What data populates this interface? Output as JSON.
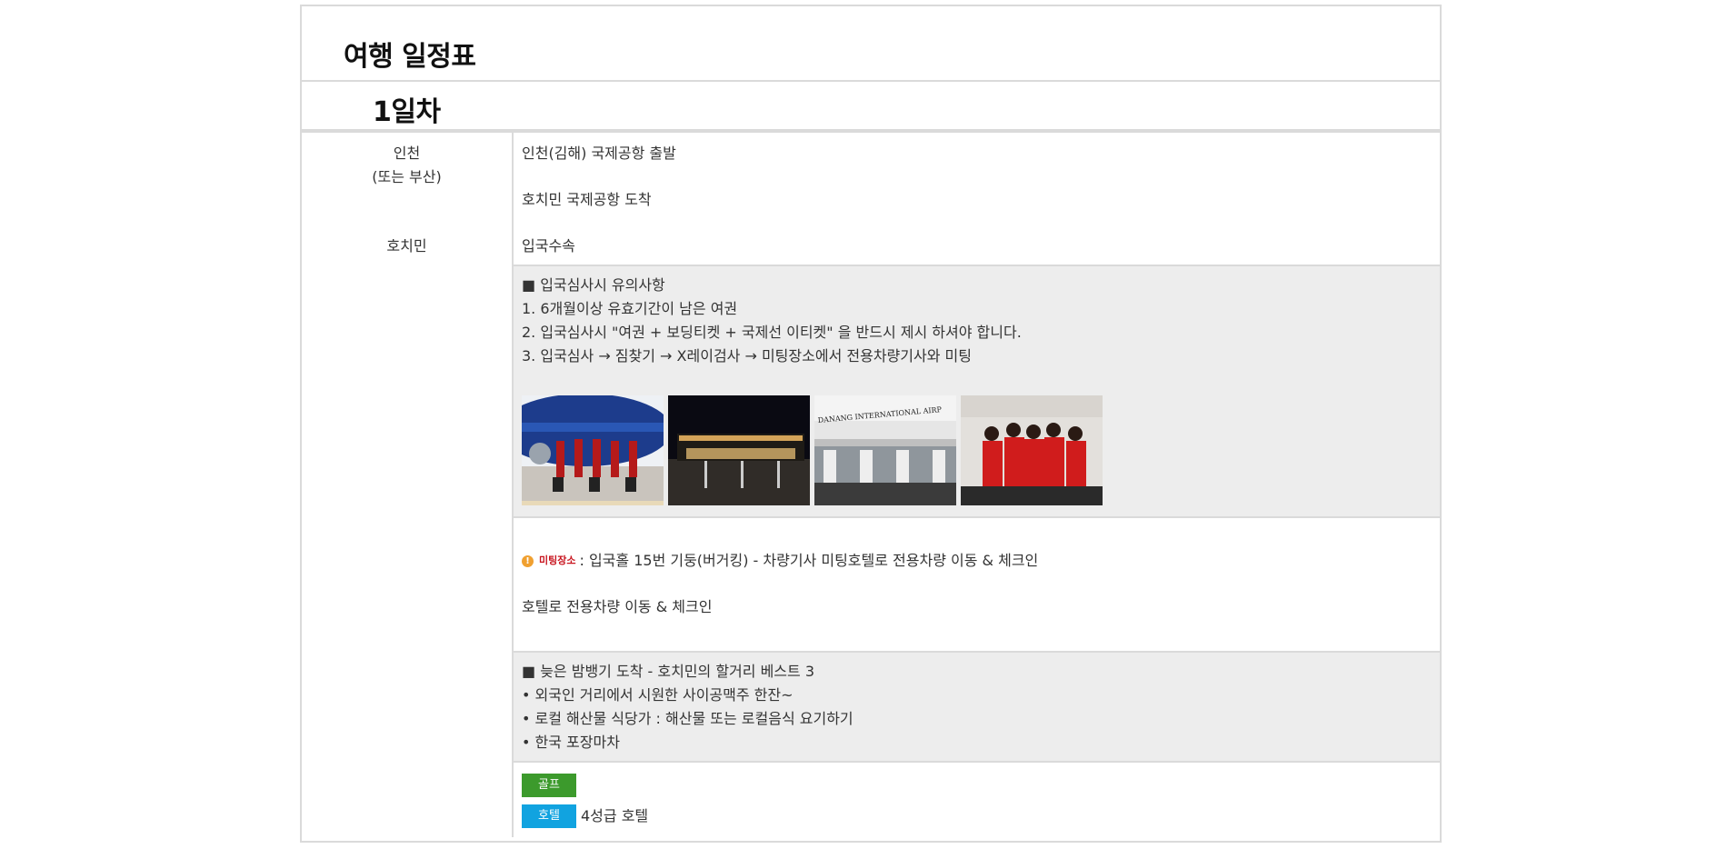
{
  "page": {
    "title": "여행 일정표",
    "day": "1일차"
  },
  "locations": {
    "origin_line1": "인천",
    "origin_line2": "(또는 부산)",
    "arrival": "호치민"
  },
  "schedule": {
    "departure": "인천(김해) 국제공항 출발",
    "arrival": "호치민 국제공항 도착",
    "immigration": "입국수속"
  },
  "immigration_notes": {
    "heading": "■ 입국심사시 유의사항",
    "items": [
      "1. 6개월이상 유효기간이 남은 여권",
      "2. 입국심사시 \"여권 + 보딩티켓 + 국제선 이티켓\" 을 반드시 제시 하셔야 합니다.",
      "3. 입국심사 → 짐찾기 → X레이검사 → 미팅장소에서 전용차량기사와 미팅"
    ],
    "photo_3_sign": "DANANG INTERNATIONAL AIRP"
  },
  "meeting": {
    "icon": "info-icon",
    "label": "미팅장소",
    "text": " : 입국홀 15번 기둥(버거킹) - 차량기사 미팅호텔로 전용차량 이동 & 체크인",
    "transfer": "호텔로 전용차량 이동 & 체크인"
  },
  "night_tips": {
    "heading": "■ 늦은 밤뱅기 도착 - 호치민의 할거리 베스트 3",
    "items": [
      "• 외국인 거리에서 시원한 사이공맥주 한잔~",
      "• 로컬 해산물 식당가 : 해산물 또는 로컬음식 요기하기",
      "• 한국 포장마차"
    ]
  },
  "tags": {
    "golf": "골프",
    "hotel": "호텔",
    "hotel_text": "4성급 호텔"
  },
  "colors": {
    "border": "#dadada",
    "gray_bg": "#ededed",
    "golf_tag": "#3c9a2c",
    "hotel_tag": "#11a3e0",
    "meeting_label": "#c8141e",
    "info_icon": "#f0a030"
  }
}
